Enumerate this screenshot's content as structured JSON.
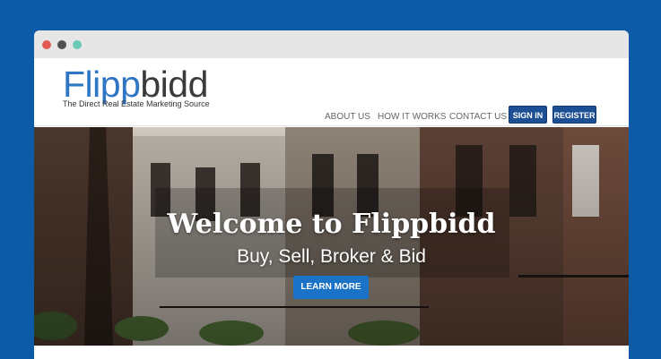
{
  "brand": {
    "logo_part1": "Flipp",
    "logo_part2": "bidd",
    "tagline": "The Direct Real Estate Marketing Source"
  },
  "nav": {
    "about": "ABOUT US",
    "how": "HOW IT WORKS",
    "contact": "CONTACT US",
    "signin": "SIGN IN",
    "register": "REGISTER"
  },
  "hero": {
    "title": "Welcome to Flippbidd",
    "subtitle": "Buy, Sell, Broker & Bid",
    "cta": "LEARN MORE"
  },
  "colors": {
    "background": "#0d5aa7",
    "nav_button": "#1c4f93",
    "cta_button": "#1b73c7",
    "logo_blue": "#2f76c4",
    "logo_dark": "#3a3a3a"
  }
}
